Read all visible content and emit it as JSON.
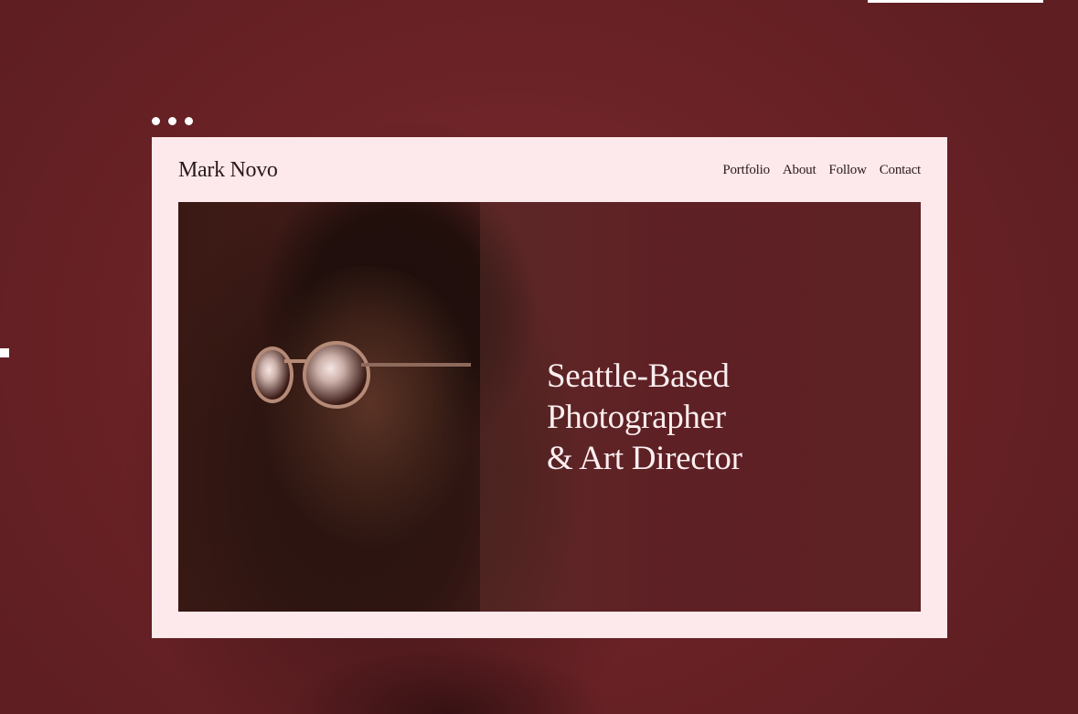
{
  "site": {
    "logo": "Mark Novo",
    "nav": [
      "Portfolio",
      "About",
      "Follow",
      "Contact"
    ]
  },
  "hero": {
    "headline_lines": [
      "Seattle-Based",
      "Photographer",
      "& Art Director"
    ]
  },
  "colors": {
    "background": "#6a2226",
    "window": "#fde9eb",
    "hero": "#5e2124",
    "text_dark": "#2a1a1a",
    "text_light": "#fbeef0"
  }
}
